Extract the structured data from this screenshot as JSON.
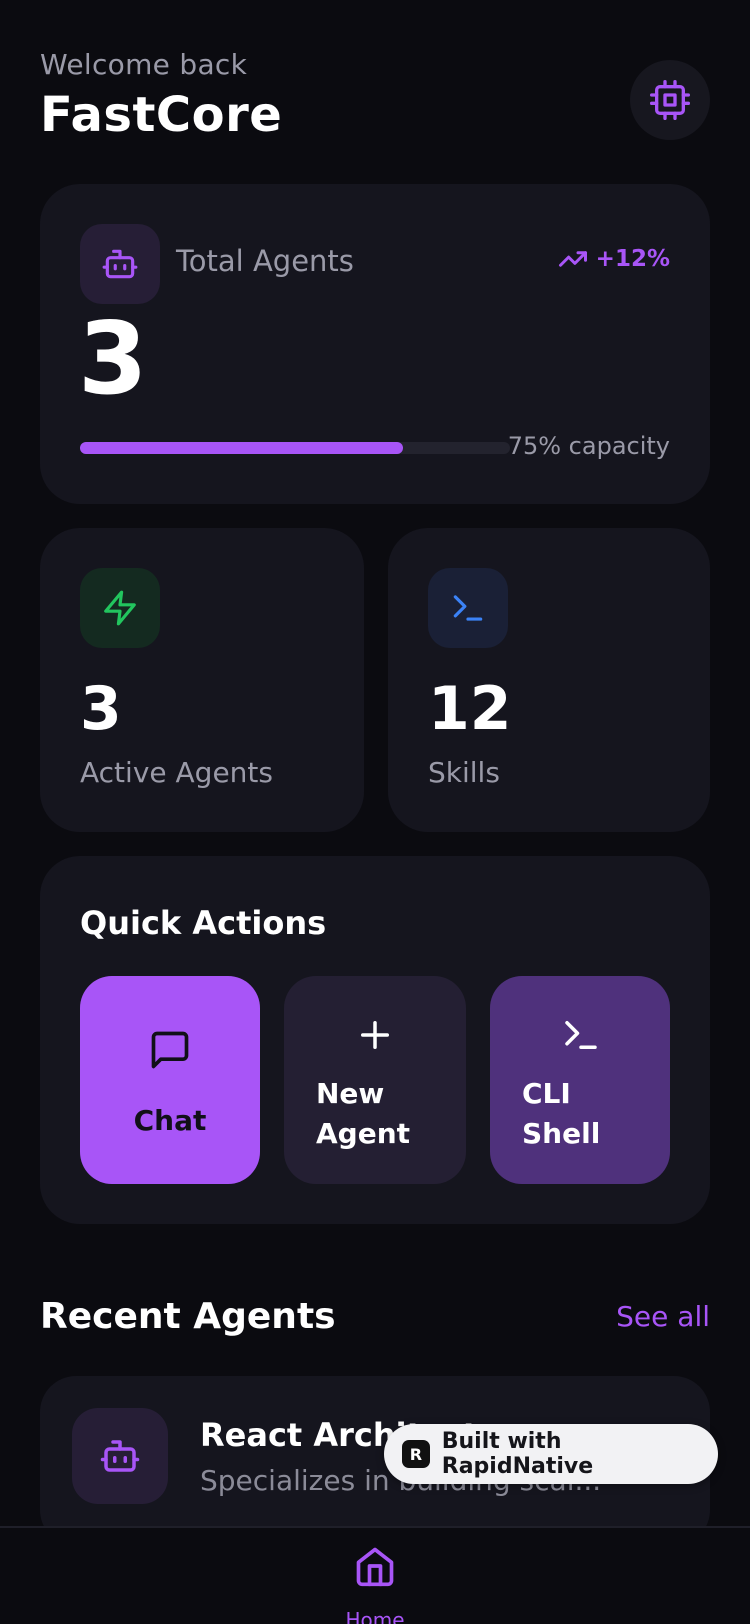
{
  "header": {
    "welcome": "Welcome back",
    "title": "FastCore",
    "settings_icon": "cpu-icon"
  },
  "total_agents": {
    "label": "Total Agents",
    "trend": "+12%",
    "value": "3",
    "capacity_fraction": 0.75,
    "capacity_text": "75% capacity"
  },
  "stats": {
    "active": {
      "value": "3",
      "label": "Active Agents",
      "icon": "zap-icon"
    },
    "skills": {
      "value": "12",
      "label": "Skills",
      "icon": "terminal-icon"
    }
  },
  "quick_actions": {
    "title": "Quick Actions",
    "chat": "Chat",
    "new_agent_line1": "New",
    "new_agent_line2": "Agent",
    "cli_line1": "CLI",
    "cli_line2": "Shell"
  },
  "recent": {
    "title": "Recent Agents",
    "see_all": "See all",
    "items": [
      {
        "name": "React Architect",
        "description": "Specializes in building scal..."
      }
    ]
  },
  "badge": {
    "text": "Built with RapidNative"
  },
  "nav": {
    "home": "Home"
  },
  "colors": {
    "accent": "#a855f7",
    "background": "#0b0b10",
    "card": "#15151e",
    "success": "#22c55e",
    "info": "#3b82f6"
  }
}
